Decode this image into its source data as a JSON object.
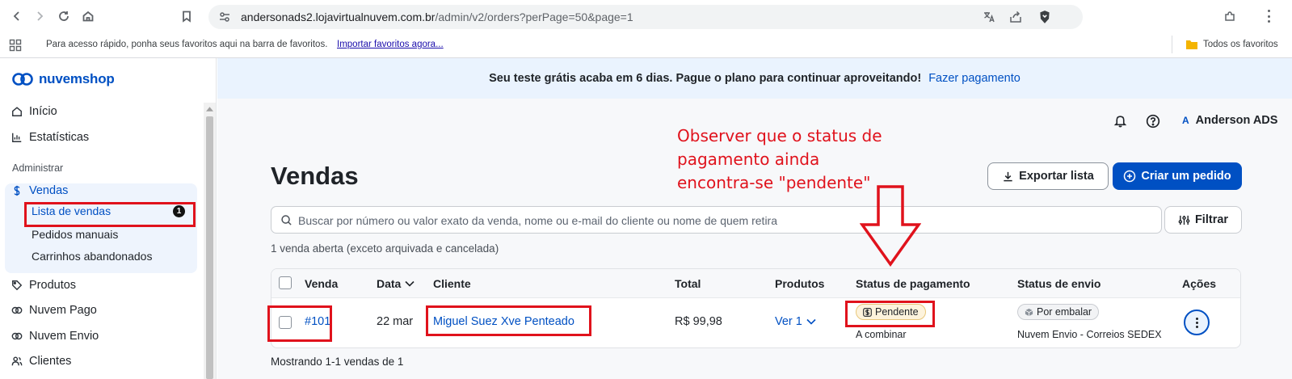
{
  "browser": {
    "url_host": "andersonads2.lojavirtualnuvem.com.br",
    "url_path": "/admin/v2/orders?perPage=50&page=1",
    "bookmarks_hint": "Para acesso rápido, ponha seus favoritos aqui na barra de favoritos.",
    "bookmarks_import": "Importar favoritos agora...",
    "all_bookmarks": "Todos os favoritos"
  },
  "sidebar": {
    "brand": "nuvemshop",
    "top_items": [
      {
        "label": "Início",
        "icon": "home-icon"
      },
      {
        "label": "Estatísticas",
        "icon": "bar-chart-icon"
      }
    ],
    "section_title": "Administrar",
    "vendas": {
      "label": "Vendas",
      "icon": "dollar-icon",
      "sub_items": [
        {
          "label": "Lista de vendas",
          "badge": "1"
        },
        {
          "label": "Pedidos manuais"
        },
        {
          "label": "Carrinhos abandonados"
        }
      ]
    },
    "bottom_items": [
      {
        "label": "Produtos",
        "icon": "tag-icon"
      },
      {
        "label": "Nuvem Pago",
        "icon": "nuvem-pago-icon"
      },
      {
        "label": "Nuvem Envio",
        "icon": "nuvem-envio-icon"
      },
      {
        "label": "Clientes",
        "icon": "users-icon"
      }
    ]
  },
  "banner": {
    "message": "Seu teste grátis acaba em 6 dias. Pague o plano para continuar aproveitando!",
    "link": "Fazer pagamento"
  },
  "header": {
    "user_initial": "A",
    "user_name": "Anderson ADS"
  },
  "page": {
    "title": "Vendas",
    "export_label": "Exportar lista",
    "create_label": "Criar um pedido",
    "search_placeholder": "Buscar por número ou valor exato da venda, nome ou e-mail do cliente ou nome de quem retira",
    "filter_label": "Filtrar",
    "open_count_text": "1 venda aberta (exceto arquivada e cancelada)",
    "footer_text": "Mostrando 1-1 vendas de 1"
  },
  "table": {
    "columns": [
      "Venda",
      "Data",
      "Cliente",
      "Total",
      "Produtos",
      "Status de pagamento",
      "Status de envio",
      "Ações"
    ],
    "rows": [
      {
        "order": "#101",
        "date": "22 mar",
        "client": "Miguel Suez Xve Penteado",
        "total": "R$ 99,98",
        "products": "Ver 1",
        "payment_status": "Pendente",
        "payment_method": "A combinar",
        "shipping_status": "Por embalar",
        "shipping_method": "Nuvem Envio - Correios SEDEX"
      }
    ]
  },
  "annotation": {
    "lines": [
      "Observer que o status de",
      "pagamento ainda",
      "encontra-se \"pendente\""
    ]
  },
  "colors": {
    "accent": "#0050c3",
    "annotation_red": "#e0121c",
    "banner_bg": "#eaf3fe",
    "pending_badge_bg": "#fdf3dc"
  }
}
